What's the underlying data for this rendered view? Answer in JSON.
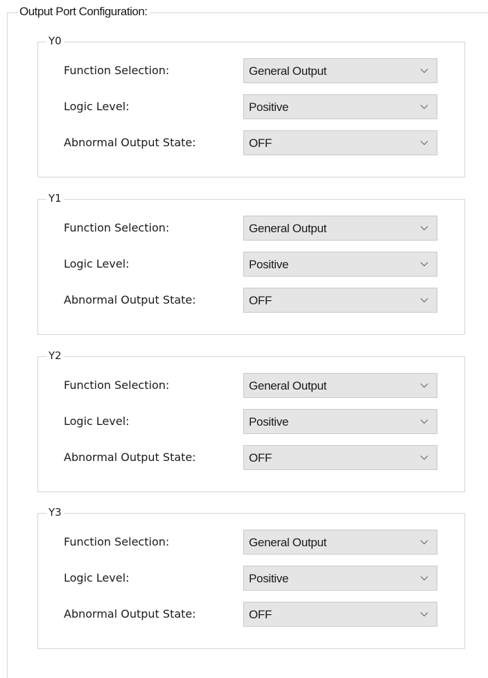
{
  "panel": {
    "title": "Output Port Configuration:"
  },
  "labels": {
    "function_selection": "Function Selection:",
    "logic_level": "Logic Level:",
    "abnormal_output_state": "Abnormal Output State:"
  },
  "ports": [
    {
      "name": "Y0",
      "function_selection": "General Output",
      "logic_level": "Positive",
      "abnormal_output_state": "OFF"
    },
    {
      "name": "Y1",
      "function_selection": "General Output",
      "logic_level": "Positive",
      "abnormal_output_state": "OFF"
    },
    {
      "name": "Y2",
      "function_selection": "General Output",
      "logic_level": "Positive",
      "abnormal_output_state": "OFF"
    },
    {
      "name": "Y3",
      "function_selection": "General Output",
      "logic_level": "Positive",
      "abnormal_output_state": "OFF"
    }
  ],
  "icons": {
    "dropdown": "chevron-down-icon"
  }
}
